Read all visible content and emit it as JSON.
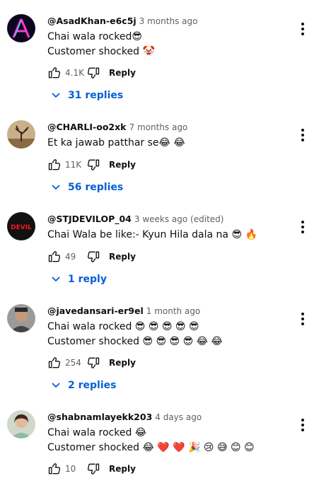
{
  "comments": [
    {
      "author": "@AsadKhan-e6c5j",
      "time": "3 months ago",
      "lines": [
        "Chai wala rocked😎",
        "Customer shocked 🤡"
      ],
      "likes": "4.1K",
      "reply_label": "Reply",
      "replies": "31 replies",
      "avatar": "neon-letter-a-avatar"
    },
    {
      "author": "@CHARLI-oo2xk",
      "time": "7 months ago",
      "lines": [
        "Et ka jawab patthar se😂 😂"
      ],
      "likes": "11K",
      "reply_label": "Reply",
      "replies": "56 replies",
      "avatar": "tree-landscape-avatar"
    },
    {
      "author": "@STJDEVILOP_04",
      "time": "3 weeks ago (edited)",
      "lines": [
        "Chai Wala be like:- Kyun Hila dala na 😎 🔥"
      ],
      "likes": "49",
      "reply_label": "Reply",
      "replies": "1 reply",
      "avatar": "devil-text-avatar",
      "avatar_text": "DEVIL"
    },
    {
      "author": "@javedansari-er9el",
      "time": "1 month ago",
      "lines": [
        "Chai wala rocked 😎 😎 😎 😎 😎",
        "Customer shocked 😎 😎 😎 😎 😂 😂"
      ],
      "likes": "254",
      "reply_label": "Reply",
      "replies": "2 replies",
      "avatar": "man-photo-avatar"
    },
    {
      "author": "@shabnamlayekk203",
      "time": "4 days ago",
      "lines": [
        "Chai wala rocked 😂",
        "Customer shocked 😂 ❤️ ❤️ 🎉 😢 😅 😊 😊"
      ],
      "likes": "10",
      "reply_label": "Reply",
      "avatar": "woman-photo-avatar"
    }
  ],
  "colors": {
    "link_blue": "#065fd4",
    "meta_gray": "#606060",
    "text": "#0f0f0f"
  }
}
